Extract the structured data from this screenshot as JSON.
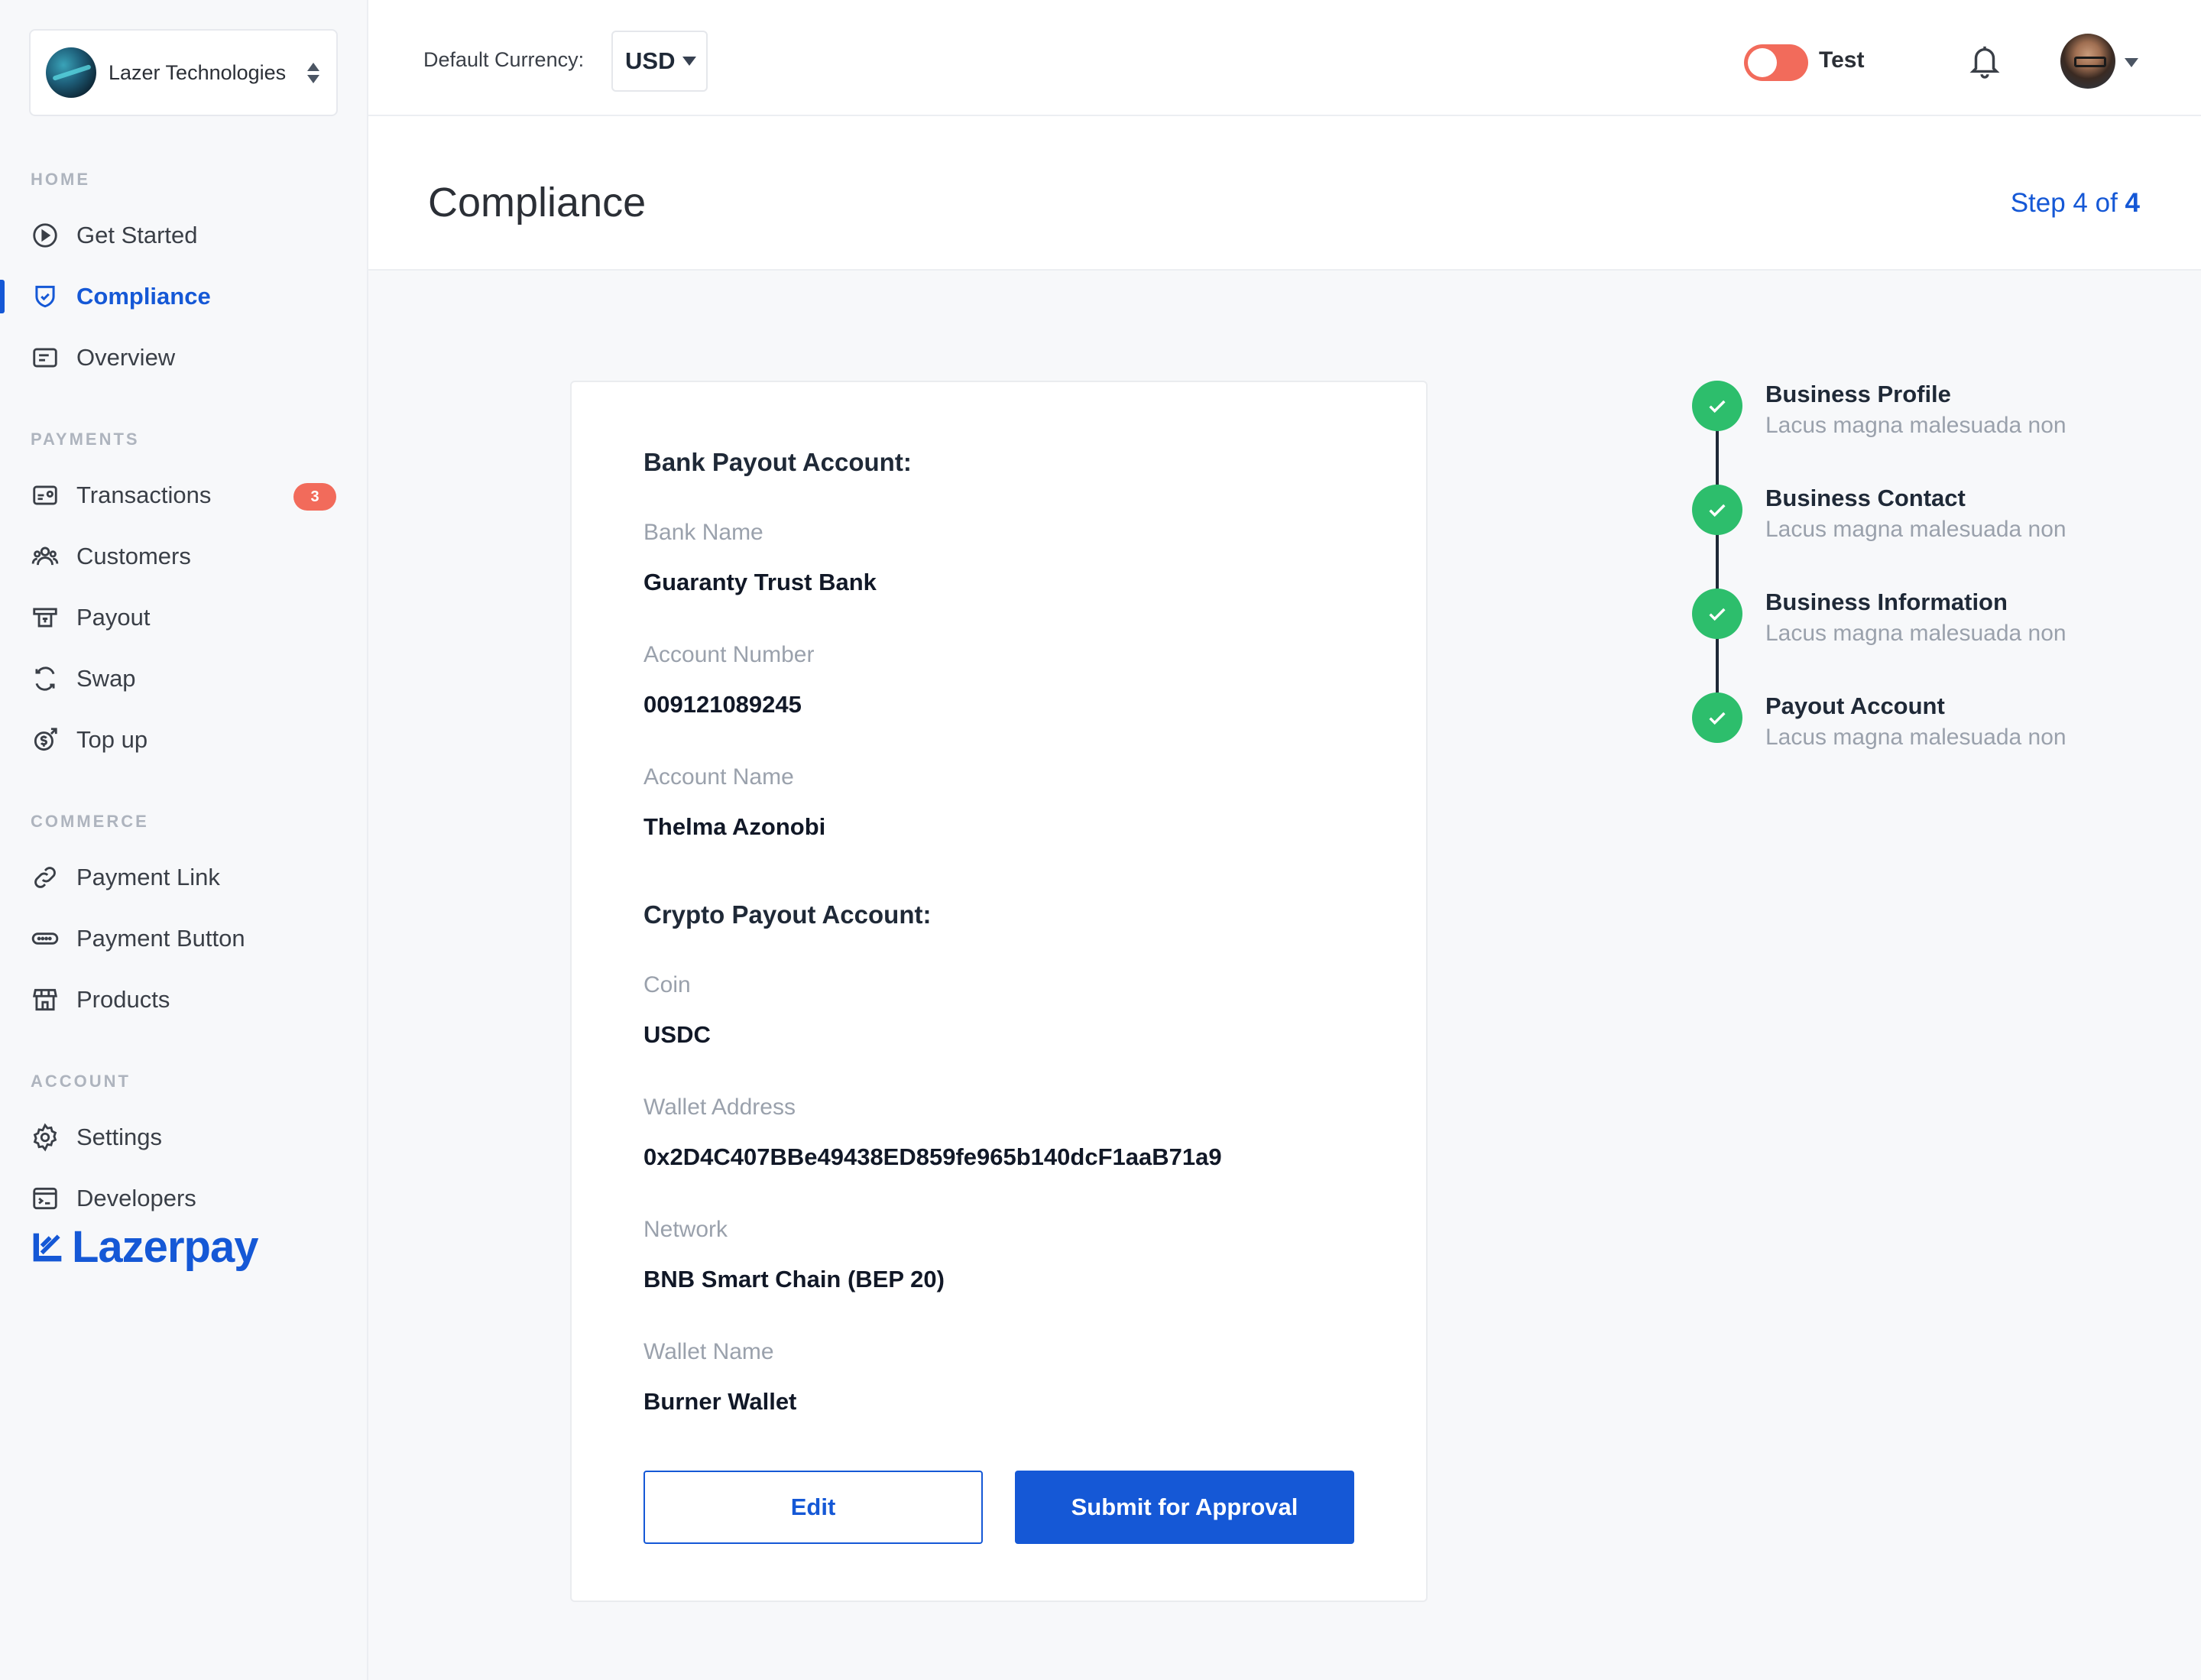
{
  "sidebar": {
    "org_name": "Lazer Technologies",
    "sections": {
      "home": "HOME",
      "payments": "PAYMENTS",
      "commerce": "COMMERCE",
      "account": "ACCOUNT"
    },
    "items": {
      "get_started": "Get Started",
      "compliance": "Compliance",
      "overview": "Overview",
      "transactions": "Transactions",
      "transactions_badge": "3",
      "customers": "Customers",
      "payout": "Payout",
      "swap": "Swap",
      "top_up": "Top up",
      "payment_link": "Payment Link",
      "payment_button": "Payment Button",
      "products": "Products",
      "settings": "Settings",
      "developers": "Developers"
    },
    "logo_text": "Lazerpay",
    "active_item": "Compliance"
  },
  "topbar": {
    "currency_label": "Default Currency:",
    "currency_value": "USD",
    "mode_label": "Test",
    "mode_toggle_on": true
  },
  "header": {
    "title": "Compliance",
    "step_prefix": "Step 4 of ",
    "step_total": "4"
  },
  "card": {
    "bank_title": "Bank Payout Account:",
    "bank_name_label": "Bank Name",
    "bank_name_value": "Guaranty Trust Bank",
    "account_number_label": "Account Number",
    "account_number_value": "009121089245",
    "account_name_label": "Account Name",
    "account_name_value": "Thelma Azonobi",
    "crypto_title": "Crypto Payout Account:",
    "coin_label": "Coin",
    "coin_value": "USDC",
    "wallet_address_label": "Wallet Address",
    "wallet_address_value": "0x2D4C407BBe49438ED859fe965b140dcF1aaB71a9",
    "network_label": "Network",
    "network_value": "BNB Smart Chain (BEP 20)",
    "wallet_name_label": "Wallet Name",
    "wallet_name_value": "Burner Wallet",
    "edit_button": "Edit",
    "submit_button": "Submit for Approval"
  },
  "steps": [
    {
      "title": "Business Profile",
      "subtitle": "Lacus magna malesuada non",
      "status": "complete"
    },
    {
      "title": "Business Contact",
      "subtitle": "Lacus magna malesuada non",
      "status": "complete"
    },
    {
      "title": "Business Information",
      "subtitle": "Lacus magna malesuada non",
      "status": "complete"
    },
    {
      "title": "Payout Account",
      "subtitle": "Lacus magna malesuada non",
      "status": "complete"
    }
  ],
  "colors": {
    "accent": "#1558D6",
    "success": "#2DBE6C",
    "badge": "#F26B5B",
    "toggle": "#F26B5B"
  }
}
